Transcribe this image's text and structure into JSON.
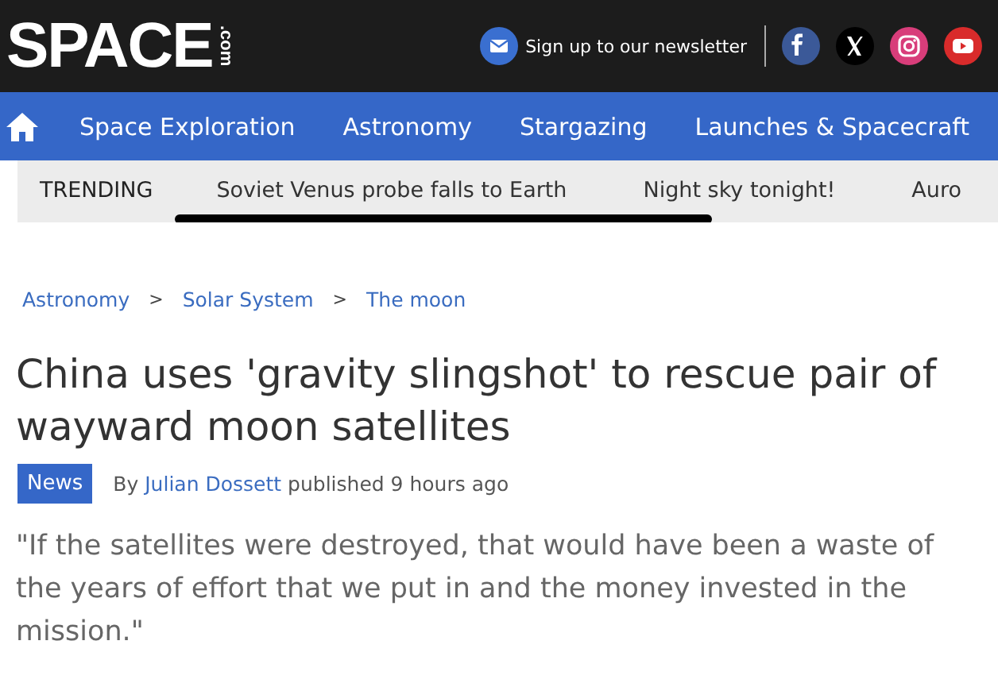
{
  "header": {
    "logo": "SPACE",
    "logo_suffix": ".com",
    "newsletter": "Sign up to our newsletter",
    "social": [
      {
        "kind": "facebook"
      },
      {
        "kind": "x"
      },
      {
        "kind": "instagram"
      },
      {
        "kind": "youtube"
      }
    ]
  },
  "nav": {
    "items": [
      "Space Exploration",
      "Astronomy",
      "Stargazing",
      "Launches & Spacecraft"
    ]
  },
  "trending": {
    "label": "TRENDING",
    "items": [
      "Soviet Venus probe falls to Earth",
      "Night sky tonight!",
      "Auro"
    ]
  },
  "breadcrumbs": [
    "Astronomy",
    "Solar System",
    "The moon"
  ],
  "breadcrumb_separator": ">",
  "article": {
    "title": "China uses 'gravity slingshot' to rescue pair of wayward moon satellites",
    "tag": "News",
    "by": "By",
    "author": "Julian Dossett",
    "published": "published 9 hours ago",
    "quote": "\"If the satellites were destroyed, that would have been a waste of the years of effort that we put in and the money invested in the mission.\""
  }
}
